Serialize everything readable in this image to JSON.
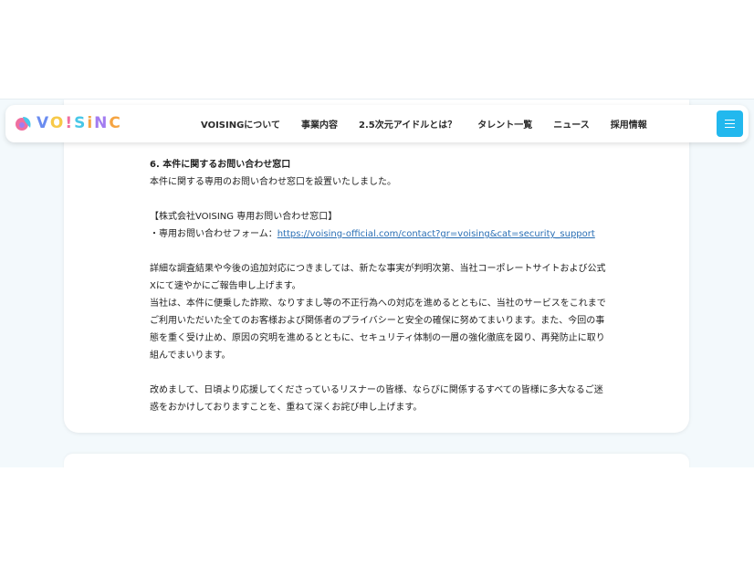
{
  "logo": {
    "parts": [
      "V",
      "O",
      "!",
      "S",
      "i",
      "N",
      "C"
    ]
  },
  "nav": {
    "items": [
      "VOISINGについて",
      "事業内容",
      "2.5次元アイドルとは？",
      "タレント一覧",
      "ニュース",
      "採用情報"
    ]
  },
  "article": {
    "heading": "6. 本件に関するお問い合わせ窓口",
    "line1": "本件に関する専用のお問い合わせ窓口を設置いたしました。",
    "line2": "【株式会社VOISING 専用お問い合わせ窓口】",
    "line3_prefix": "・専用お問い合わせフォーム：",
    "line3_link": "https://voising-official.com/contact?gr=voising&cat=security_support",
    "para1_l1": "詳細な調査結果や今後の追加対応につきましては、新たな事実が判明次第、当社コーポレートサイトおよび公式",
    "para1_l2": "Xにて速やかにご報告申し上げます。",
    "para2_l1": "当社は、本件に便乗した詐欺、なりすまし等の不正行為への対応を進めるとともに、当社のサービスをこれまで",
    "para2_l2": "ご利用いただいた全てのお客様および関係者のプライバシーと安全の確保に努めてまいります。また、今回の事",
    "para2_l3": "態を重く受け止め、原因の究明を進めるとともに、セキュリティ体制の一層の強化徹底を図り、再発防止に取り",
    "para2_l4": "組んでまいります。",
    "para3_l1": "改めまして、日頃より応援してくださっているリスナーの皆様、ならびに関係するすべての皆様に多大なるご迷",
    "para3_l2": "惑をおかけしておりますことを、重ねて深くお詫び申し上げます。"
  },
  "colors": {
    "accent": "#22b8ee",
    "link": "#2a6fb5",
    "page_bg": "#f3f9fc"
  }
}
